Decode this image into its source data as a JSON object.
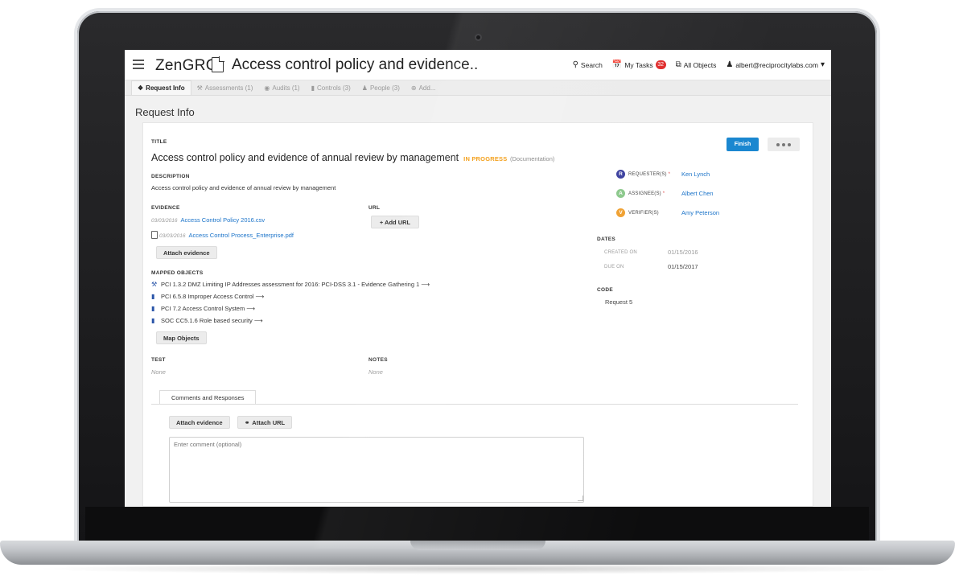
{
  "app": {
    "brand": "ZenGRC",
    "page_title": "Access control policy and evidence.."
  },
  "nav": {
    "search": "Search",
    "my_tasks": "My Tasks",
    "my_tasks_badge": "32",
    "all_objects": "All Objects",
    "user": "albert@reciprocitylabs.com"
  },
  "tabs": [
    {
      "label": "Request Info",
      "icon": "info-circle-icon",
      "active": true
    },
    {
      "label": "Assessments (1)",
      "icon": "gavel-icon"
    },
    {
      "label": "Audits (1)",
      "icon": "eye-icon"
    },
    {
      "label": "Controls (3)",
      "icon": "video-camera-icon"
    },
    {
      "label": "People (3)",
      "icon": "people-icon"
    },
    {
      "label": "Add...",
      "icon": "plus-circle-icon"
    }
  ],
  "section_title": "Request Info",
  "request": {
    "title_label": "TITLE",
    "title": "Access control policy and evidence of annual review by management",
    "status": "IN PROGRESS",
    "status_type": "(Documentation)",
    "finish_label": "Finish",
    "description_label": "DESCRIPTION",
    "description": "Access control policy and evidence of annual review by management",
    "evidence_label": "EVIDENCE",
    "evidence": [
      {
        "date": "03/03/2016",
        "name": "Access Control Policy 2016.csv",
        "icon": ""
      },
      {
        "date": "03/03/2016",
        "name": "Access Control Process_Enterprise.pdf",
        "icon": "file-icon"
      }
    ],
    "attach_evidence_label": "Attach evidence",
    "url_label": "URL",
    "add_url_label": "+ Add URL",
    "mapped_label": "MAPPED OBJECTS",
    "mapped": [
      {
        "text": "PCI 1.3.2 DMZ Limiting IP Addresses assessment for 2016: PCI-DSS 3.1 - Evidence Gathering 1 ⟶",
        "icon": "gavel-icon"
      },
      {
        "text": "PCI 6.5.8 Improper Access Control ⟶",
        "icon": "video-camera-icon"
      },
      {
        "text": "PCI 7.2 Access Control System ⟶",
        "icon": "video-camera-icon"
      },
      {
        "text": "SOC CC5.1.6 Role based security ⟶",
        "icon": "video-camera-icon"
      }
    ],
    "map_objects_label": "Map Objects",
    "test_label": "TEST",
    "test_value": "None",
    "notes_label": "NOTES",
    "notes_value": "None"
  },
  "people": [
    {
      "initial": "R",
      "role": "REQUESTER(S)",
      "required": "*",
      "name": "Ken Lynch",
      "color": "#3b3f9e"
    },
    {
      "initial": "A",
      "role": "ASSIGNEE(S)",
      "required": "*",
      "name": "Albert Chen",
      "color": "#8bc88b"
    },
    {
      "initial": "V",
      "role": "VERIFIER(S)",
      "required": "",
      "name": "Amy Peterson",
      "color": "#f0a030"
    }
  ],
  "dates": {
    "label": "DATES",
    "created_label": "CREATED ON",
    "created_value": "01/15/2016",
    "due_label": "DUE ON",
    "due_value": "01/15/2017"
  },
  "code": {
    "label": "CODE",
    "value": "Request 5"
  },
  "comments": {
    "tab_label": "Comments and Responses",
    "attach_evidence_label": "Attach evidence",
    "attach_url_label": "Attach URL",
    "placeholder": "Enter comment (optional)"
  },
  "colors": {
    "accent_blue": "#1a87d0",
    "status_orange": "#f39c12",
    "badge_red": "#e02b2b"
  }
}
